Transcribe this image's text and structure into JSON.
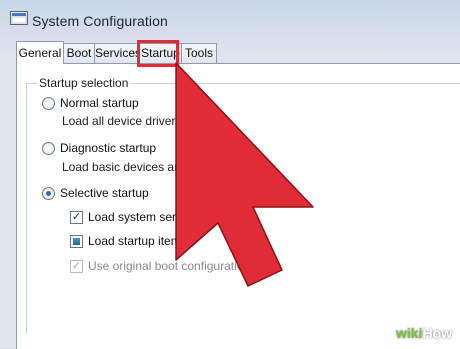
{
  "window": {
    "title": "System Configuration"
  },
  "tabs": [
    {
      "label": "General"
    },
    {
      "label": "Boot"
    },
    {
      "label": "Services"
    },
    {
      "label": "Startup"
    },
    {
      "label": "Tools"
    }
  ],
  "active_tab": "General",
  "highlighted_tab": "Startup",
  "startup_selection": {
    "label": "Startup selection",
    "options": [
      {
        "label": "Normal startup",
        "description": "Load all device drivers and",
        "selected": false
      },
      {
        "label": "Diagnostic startup",
        "description": "Load basic devices and se",
        "selected": false
      },
      {
        "label": "Selective startup",
        "selected": true
      }
    ],
    "checkboxes": [
      {
        "label": "Load system service",
        "state": "checked"
      },
      {
        "label": "Load startup items",
        "state": "indeterminate"
      },
      {
        "label": "Use original boot configuration",
        "state": "checked-disabled"
      }
    ]
  },
  "annotation": {
    "highlight_color": "#e12b36",
    "arrow_color": "#e12b36"
  },
  "watermark": {
    "part1": "wiki",
    "part2": "How"
  }
}
